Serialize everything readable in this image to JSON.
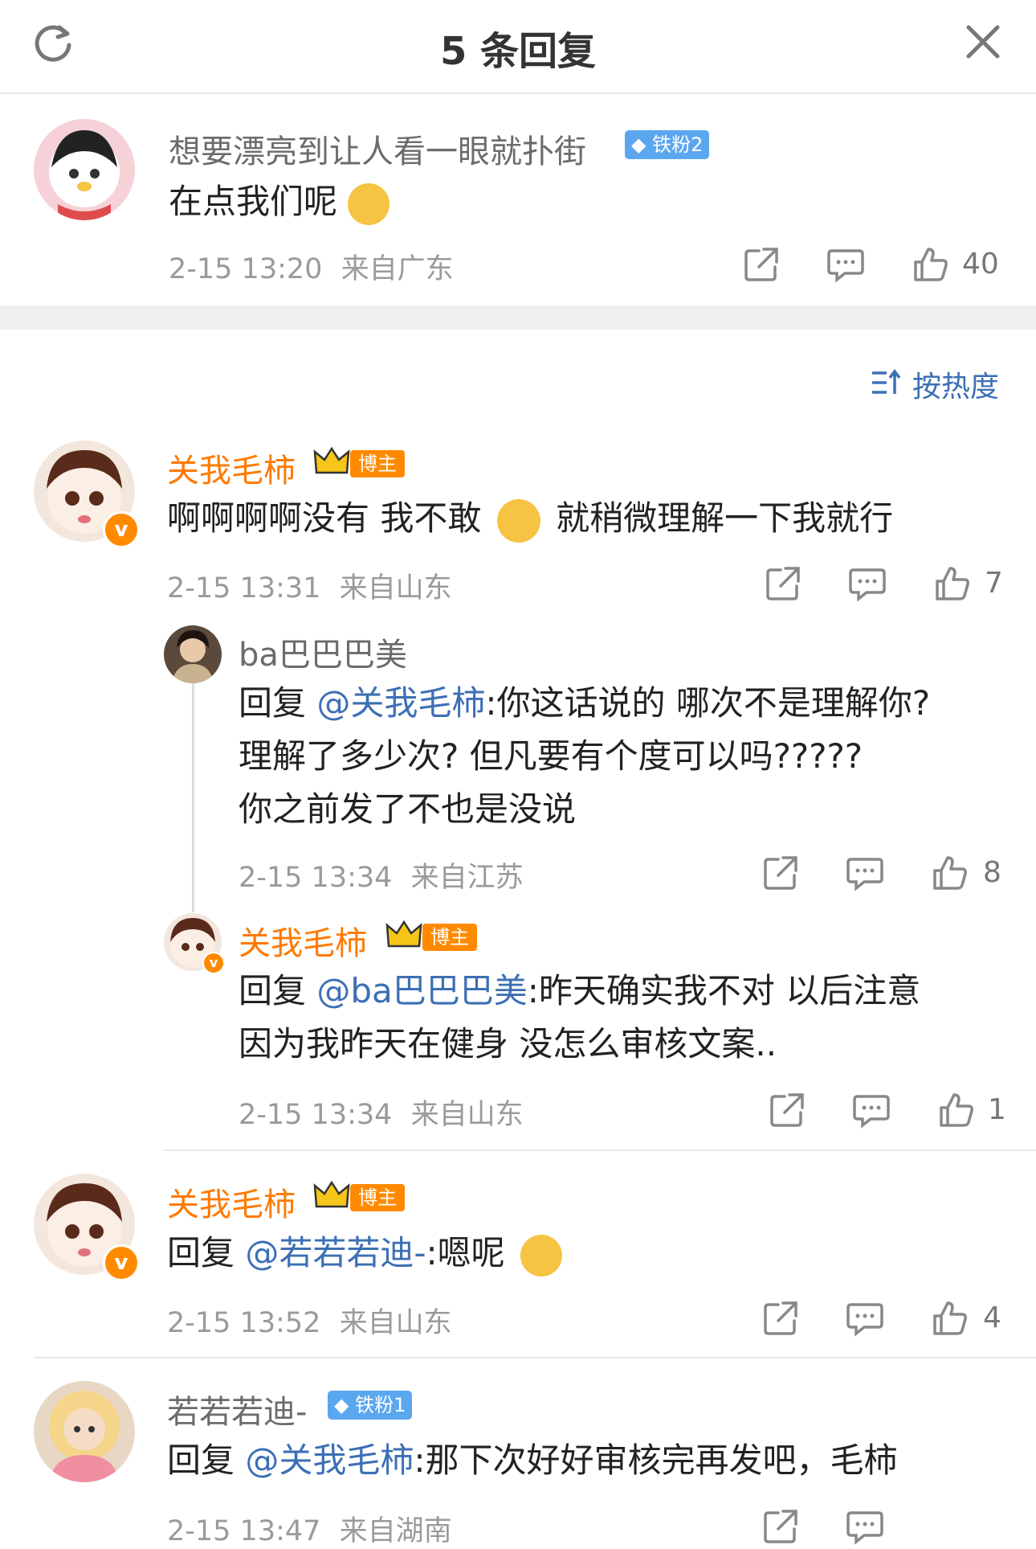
{
  "header": {
    "title": "5 条回复"
  },
  "root": {
    "username": "想要漂亮到让人看一眼就扑街",
    "badge": "铁粉2",
    "text": "在点我们呢",
    "time": "2-15 13:20",
    "location": "来自广东",
    "likes": "40"
  },
  "sort": {
    "label": "按热度"
  },
  "comments": [
    {
      "username": "关我毛柿",
      "badge": "博主",
      "text_a": "啊啊啊啊没有 我不敢",
      "text_b": "就稍微理解一下我就行",
      "time": "2-15 13:31",
      "location": "来自山东",
      "likes": "7"
    },
    {
      "username": "关我毛柿",
      "badge": "博主",
      "reply_prefix": "回复 ",
      "mention": "@若若若迪-",
      "text": ":嗯呢",
      "time": "2-15 13:52",
      "location": "来自山东",
      "likes": "4"
    },
    {
      "username": "若若若迪-",
      "badge": "铁粉1",
      "reply_prefix": "回复 ",
      "mention": "@关我毛柿",
      "text": ":那下次好好审核完再发吧，毛柿",
      "time": "2-15 13:47",
      "location": "来自湖南"
    }
  ],
  "subreplies": [
    {
      "username": "ba巴巴巴美",
      "reply_prefix": "回复 ",
      "mention": "@关我毛柿",
      "line1": ":你这话说的 哪次不是理解你?",
      "line2": "理解了多少次? 但凡要有个度可以吗?????",
      "line3": "你之前发了不也是没说",
      "time": "2-15 13:34",
      "location": "来自江苏",
      "likes": "8"
    },
    {
      "username": "关我毛柿",
      "badge": "博主",
      "reply_prefix": "回复 ",
      "mention": "@ba巴巴巴美",
      "line1": ":昨天确实我不对 以后注意",
      "line2": "因为我昨天在健身 没怎么审核文案..",
      "time": "2-15 13:34",
      "location": "来自山东",
      "likes": "1"
    }
  ],
  "icons": [
    "refresh-icon",
    "close-icon",
    "share-icon",
    "comment-icon",
    "like-icon",
    "sort-icon",
    "crown-icon",
    "verified-icon",
    "diamond-icon"
  ],
  "colors": {
    "accent_orange": "#ff7a00",
    "mention_blue": "#3c6fb5",
    "badge_blue": "#5aa7ef",
    "verified": "#ff8a00"
  }
}
